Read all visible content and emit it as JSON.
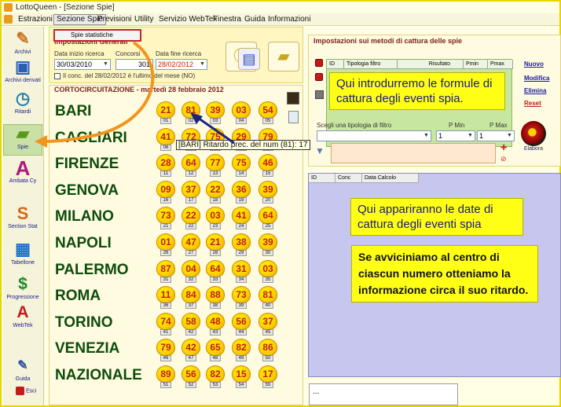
{
  "app": {
    "title": "LottoQueen - [Sezione Spie]"
  },
  "menu": [
    {
      "label": "Estrazioni"
    },
    {
      "label": "Sezione Spie"
    },
    {
      "label": "Previsioni"
    },
    {
      "label": "Utility"
    },
    {
      "label": "Servizio WebTek"
    },
    {
      "label": "Finestra"
    },
    {
      "label": "Guida"
    },
    {
      "label": "Informazioni"
    }
  ],
  "sidebar": {
    "items": [
      {
        "label": "Archivi"
      },
      {
        "label": "Archivi derivati"
      },
      {
        "label": "Ritardi"
      },
      {
        "label": "Spie"
      },
      {
        "label": "Ambata Cy"
      },
      {
        "label": "Section Stat"
      },
      {
        "label": "Tabellone"
      },
      {
        "label": "Progressione"
      },
      {
        "label": "WebTek"
      },
      {
        "label": "Guida"
      },
      {
        "label": "Esci"
      }
    ]
  },
  "submenu": {
    "label": "Spie statistiche"
  },
  "search": {
    "title": "Impostazioni Generali",
    "start_label": "Data inizio ricerca",
    "start_value": "30/03/2010",
    "concorsi_label": "Concorsi",
    "concorsi_value": "301",
    "end_label": "Data fine ricerca",
    "end_value": "28/02/2012",
    "checkbox_label": "Il conc. del 28/02/2012 è l'ultimo del mese (NO)"
  },
  "draw": {
    "title": "CORTOCIRCUITAZIONE - martedì 28 febbraio 2012",
    "rows": [
      {
        "city": "BARI",
        "nums": [
          "21",
          "81",
          "39",
          "03",
          "54"
        ],
        "idx": [
          "01",
          "02",
          "03",
          "04",
          "05"
        ]
      },
      {
        "city": "CAGLIARI",
        "nums": [
          "41",
          "72",
          "75",
          "29",
          "79"
        ],
        "idx": [
          "06",
          "07",
          "08",
          "09",
          "10"
        ]
      },
      {
        "city": "FIRENZE",
        "nums": [
          "28",
          "64",
          "77",
          "75",
          "46"
        ],
        "idx": [
          "11",
          "12",
          "13",
          "14",
          "15"
        ]
      },
      {
        "city": "GENOVA",
        "nums": [
          "09",
          "37",
          "22",
          "36",
          "39"
        ],
        "idx": [
          "16",
          "17",
          "18",
          "19",
          "20"
        ]
      },
      {
        "city": "MILANO",
        "nums": [
          "73",
          "22",
          "03",
          "41",
          "64"
        ],
        "idx": [
          "21",
          "22",
          "23",
          "24",
          "25"
        ]
      },
      {
        "city": "NAPOLI",
        "nums": [
          "01",
          "47",
          "21",
          "38",
          "39"
        ],
        "idx": [
          "26",
          "27",
          "28",
          "29",
          "30"
        ]
      },
      {
        "city": "PALERMO",
        "nums": [
          "87",
          "04",
          "64",
          "31",
          "03"
        ],
        "idx": [
          "31",
          "32",
          "33",
          "34",
          "35"
        ]
      },
      {
        "city": "ROMA",
        "nums": [
          "11",
          "84",
          "88",
          "73",
          "81"
        ],
        "idx": [
          "36",
          "37",
          "38",
          "39",
          "40"
        ]
      },
      {
        "city": "TORINO",
        "nums": [
          "74",
          "58",
          "48",
          "56",
          "37"
        ],
        "idx": [
          "41",
          "42",
          "43",
          "44",
          "45"
        ]
      },
      {
        "city": "VENEZIA",
        "nums": [
          "79",
          "42",
          "65",
          "82",
          "86"
        ],
        "idx": [
          "46",
          "47",
          "48",
          "49",
          "50"
        ]
      },
      {
        "city": "NAZIONALE",
        "nums": [
          "89",
          "56",
          "82",
          "15",
          "17"
        ],
        "idx": [
          "51",
          "52",
          "53",
          "54",
          "55"
        ]
      }
    ]
  },
  "tooltip": {
    "text": "[BARI] Ritardo prec. del num (81): 17"
  },
  "capture": {
    "title": "Impostazioni sui metodi di cattura delle spie",
    "columns": [
      "ID",
      "Tipologia filtro",
      "Risultato",
      "Pmin",
      "Pmax"
    ],
    "links": {
      "new": "Nuovo",
      "edit": "Modifica",
      "delete": "Elimina",
      "reset": "Reset"
    },
    "filter_label": "Scegli una tipologia di filtro",
    "pmin_label": "P Min",
    "pmax_label": "P Max",
    "pmin_value": "1",
    "pmax_value": "1",
    "elabora_label": "Elabora"
  },
  "results": {
    "columns": [
      "ID",
      "Conc",
      "Data Calcolo"
    ],
    "status": "..."
  },
  "callouts": {
    "one": "Qui introdurremo le formule di cattura degli eventi spia.",
    "two": "Qui appariranno le date di cattura degli eventi spia",
    "three": "Se avviciniamo al centro di ciascun numero otteniamo la informazione circa il suo ritardo."
  },
  "colors": {
    "accent": "#e7d400",
    "callout": "#ffff16",
    "city": "#0d4d0d",
    "number": "#c11a1a",
    "results_bg": "#c6c6ee"
  }
}
